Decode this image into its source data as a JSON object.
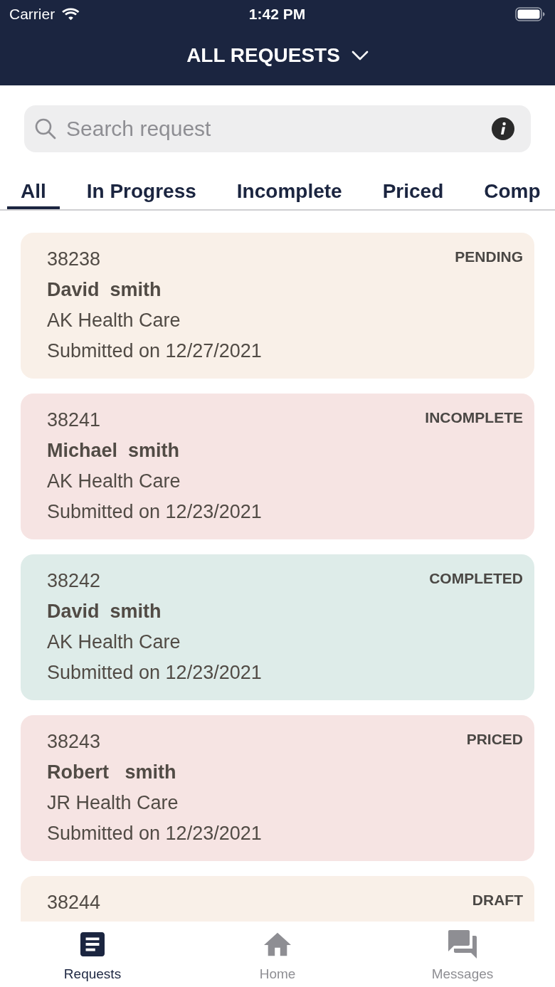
{
  "status_bar": {
    "carrier": "Carrier",
    "time": "1:42 PM"
  },
  "header": {
    "title": "ALL REQUESTS"
  },
  "search": {
    "placeholder": "Search request"
  },
  "tabs": [
    {
      "label": "All",
      "selected": true
    },
    {
      "label": "In Progress",
      "selected": false
    },
    {
      "label": "Incomplete",
      "selected": false
    },
    {
      "label": "Priced",
      "selected": false
    },
    {
      "label": "Comp",
      "selected": false
    }
  ],
  "requests": [
    {
      "number": "38238",
      "name": "David  smith",
      "organization": "AK Health Care",
      "submitted": "Submitted on 12/27/2021",
      "status": "PENDING",
      "color": "#f9f0e8"
    },
    {
      "number": "38241",
      "name": "Michael  smith",
      "organization": "AK Health Care",
      "submitted": "Submitted on 12/23/2021",
      "status": "INCOMPLETE",
      "color": "#f6e4e3"
    },
    {
      "number": "38242",
      "name": "David  smith",
      "organization": "AK Health Care",
      "submitted": "Submitted on 12/23/2021",
      "status": "COMPLETED",
      "color": "#deece9"
    },
    {
      "number": "38243",
      "name": "Robert   smith",
      "organization": "JR Health Care",
      "submitted": "Submitted on 12/23/2021",
      "status": "PRICED",
      "color": "#f6e4e3"
    },
    {
      "number": "38244",
      "status": "DRAFT",
      "color": "#f9f0e8"
    }
  ],
  "bottom_nav": [
    {
      "label": "Requests",
      "selected": true
    },
    {
      "label": "Home",
      "selected": false
    },
    {
      "label": "Messages",
      "selected": false
    }
  ]
}
